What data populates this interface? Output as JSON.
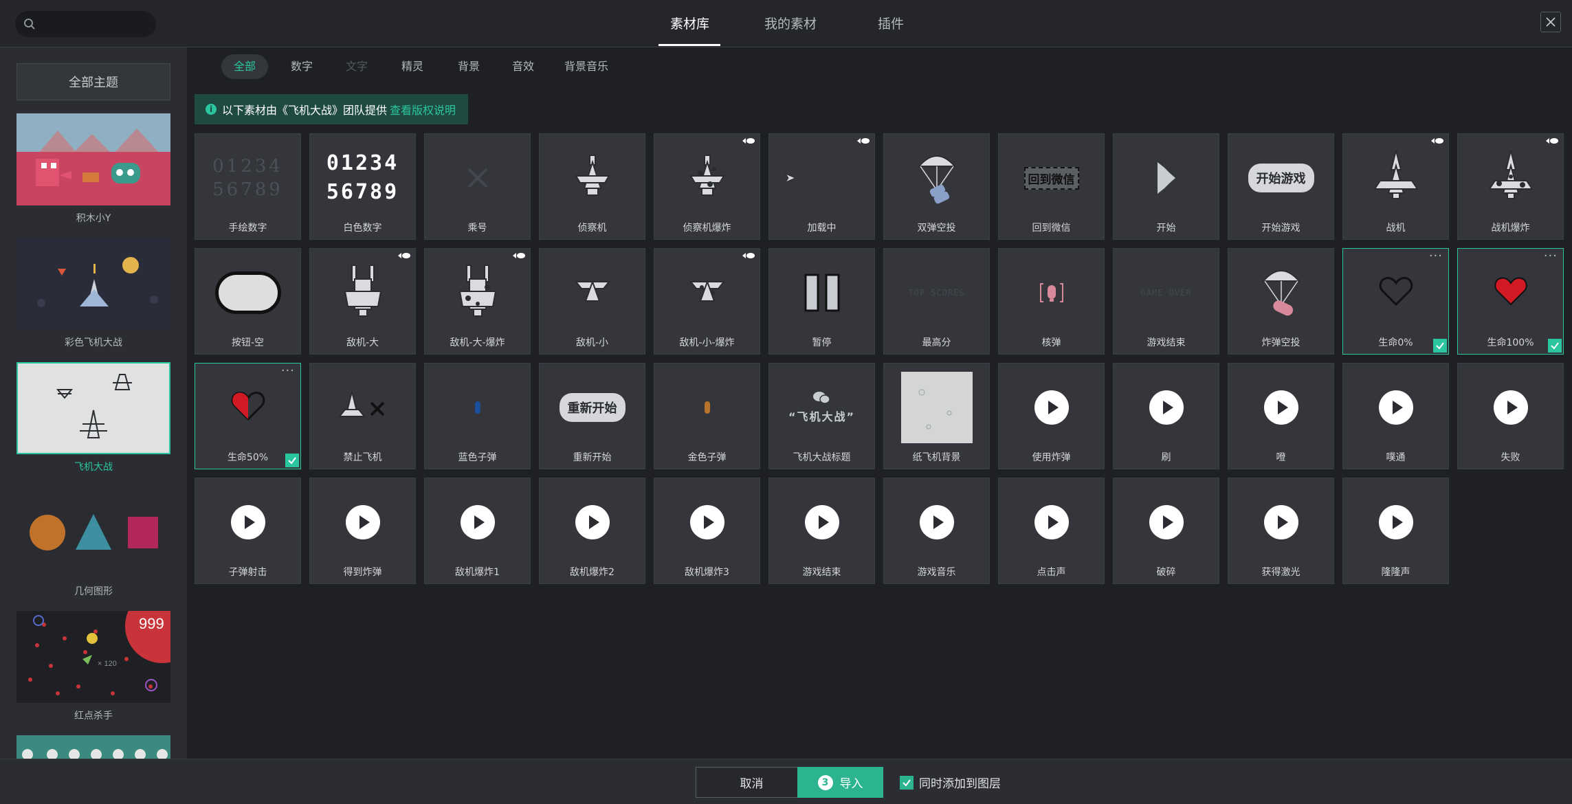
{
  "header": {
    "tabs": [
      {
        "label": "素材库",
        "active": true
      },
      {
        "label": "我的素材",
        "active": false
      },
      {
        "label": "插件",
        "active": false
      }
    ]
  },
  "sidebar": {
    "all_themes_label": "全部主题",
    "themes": [
      {
        "label": "积木小Y",
        "active": false
      },
      {
        "label": "彩色飞机大战",
        "active": false
      },
      {
        "label": "飞机大战",
        "active": true
      },
      {
        "label": "几何图形",
        "active": false
      },
      {
        "label": "红点杀手",
        "active": false,
        "thumb_score": "999",
        "thumb_counter": "× 120"
      }
    ]
  },
  "filters": [
    {
      "label": "全部",
      "state": "active"
    },
    {
      "label": "数字",
      "state": "normal"
    },
    {
      "label": "文字",
      "state": "disabled"
    },
    {
      "label": "精灵",
      "state": "normal"
    },
    {
      "label": "背景",
      "state": "normal"
    },
    {
      "label": "音效",
      "state": "normal"
    },
    {
      "label": "背景音乐",
      "state": "normal"
    }
  ],
  "notice": {
    "text": "以下素材由《飞机大战》团队提供",
    "link": "查看版权说明"
  },
  "assets": [
    {
      "label": "手绘数字",
      "visual": "handdigits",
      "top": "01234",
      "bottom": "56789"
    },
    {
      "label": "白色数字",
      "visual": "whitedigits",
      "top": "01234",
      "bottom": "56789"
    },
    {
      "label": "乘号",
      "visual": "multiply"
    },
    {
      "label": "侦察机",
      "visual": "plane"
    },
    {
      "label": "侦察机爆炸",
      "visual": "plane-burst",
      "animated": true
    },
    {
      "label": "加载中",
      "visual": "small-ship",
      "animated": true
    },
    {
      "label": "双弹空投",
      "visual": "parachute"
    },
    {
      "label": "回到微信",
      "visual": "boxtext",
      "text": "回到微信"
    },
    {
      "label": "开始",
      "visual": "start-shape"
    },
    {
      "label": "开始游戏",
      "visual": "pill",
      "text": "开始游戏"
    },
    {
      "label": "战机",
      "visual": "fighter",
      "animated": true
    },
    {
      "label": "战机爆炸",
      "visual": "fighter-burst",
      "animated": true
    },
    {
      "label": "按钮-空",
      "visual": "empty-button"
    },
    {
      "label": "敌机-大",
      "visual": "big-enemy",
      "animated": true
    },
    {
      "label": "敌机-大-爆炸",
      "visual": "big-enemy-burst",
      "animated": true
    },
    {
      "label": "敌机-小",
      "visual": "small-enemy"
    },
    {
      "label": "敌机-小-爆炸",
      "visual": "small-enemy-burst",
      "animated": true
    },
    {
      "label": "暂停",
      "visual": "pause"
    },
    {
      "label": "最高分",
      "visual": "faint",
      "text": "TOP SCORES"
    },
    {
      "label": "核弹",
      "visual": "nuke"
    },
    {
      "label": "游戏结束",
      "visual": "faint",
      "text": "GAME OVER"
    },
    {
      "label": "炸弹空投",
      "visual": "parachute-bomb"
    },
    {
      "label": "生命0%",
      "visual": "heart-empty",
      "selected": true
    },
    {
      "label": "生命100%",
      "visual": "heart-full",
      "selected": true
    },
    {
      "label": "生命50%",
      "visual": "heart-half",
      "selected": true
    },
    {
      "label": "禁止飞机",
      "visual": "no-plane"
    },
    {
      "label": "蓝色子弹",
      "visual": "bullet",
      "color": "#1b4f9e"
    },
    {
      "label": "重新开始",
      "visual": "pill",
      "text": "重新开始"
    },
    {
      "label": "金色子弹",
      "visual": "bullet",
      "color": "#b8732a"
    },
    {
      "label": "飞机大战标题",
      "visual": "title",
      "text": "“飞机大战”"
    },
    {
      "label": "纸飞机背景",
      "visual": "paper-bg"
    },
    {
      "label": "使用炸弹",
      "visual": "play"
    },
    {
      "label": "刷",
      "visual": "play"
    },
    {
      "label": "噔",
      "visual": "play"
    },
    {
      "label": "噗通",
      "visual": "play"
    },
    {
      "label": "失败",
      "visual": "play"
    },
    {
      "label": "子弹射击",
      "visual": "play"
    },
    {
      "label": "得到炸弹",
      "visual": "play"
    },
    {
      "label": "敌机爆炸1",
      "visual": "play"
    },
    {
      "label": "敌机爆炸2",
      "visual": "play"
    },
    {
      "label": "敌机爆炸3",
      "visual": "play"
    },
    {
      "label": "游戏结束",
      "visual": "play"
    },
    {
      "label": "游戏音乐",
      "visual": "play"
    },
    {
      "label": "点击声",
      "visual": "play"
    },
    {
      "label": "破碎",
      "visual": "play"
    },
    {
      "label": "获得激光",
      "visual": "play"
    },
    {
      "label": "隆隆声",
      "visual": "play"
    }
  ],
  "footer": {
    "cancel_label": "取消",
    "import_label": "导入",
    "import_count": "3",
    "sync_label": "同时添加到图层",
    "sync_checked": true
  },
  "colors": {
    "accent": "#2bc6a0",
    "background": "#1e2024",
    "card": "#34363b"
  }
}
